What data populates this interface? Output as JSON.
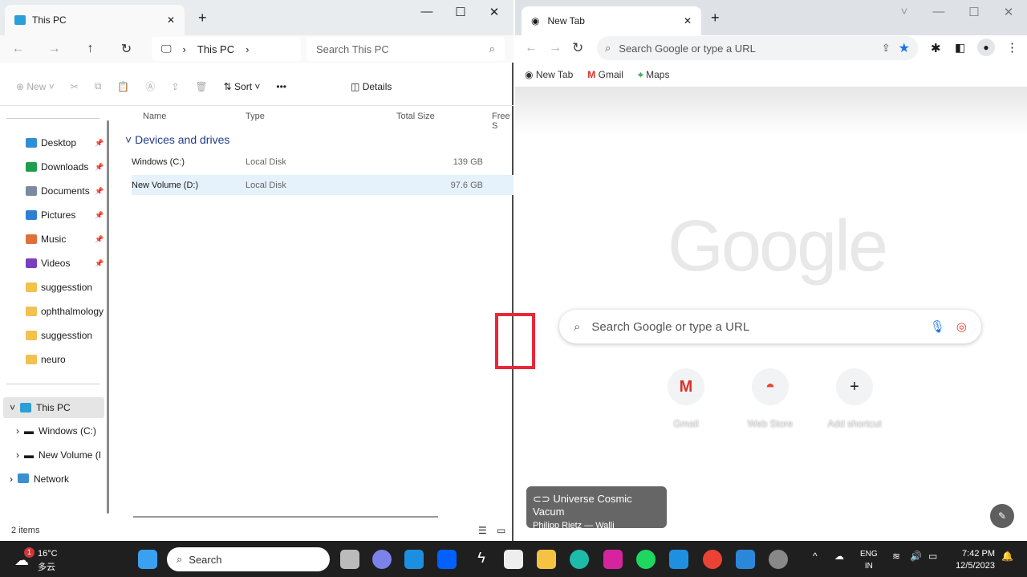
{
  "explorer": {
    "tab_title": "This PC",
    "breadcrumb": "This PC",
    "search_placeholder": "Search This PC",
    "toolbar": {
      "new": "New",
      "sort": "Sort",
      "more": "•••",
      "details": "Details"
    },
    "columns": [
      "Name",
      "Type",
      "Total Size",
      "Free S"
    ],
    "group": "Devices and drives",
    "drives": [
      {
        "name": "Windows (C:)",
        "type": "Local Disk",
        "size": "139 GB"
      },
      {
        "name": "New Volume (D:)",
        "type": "Local Disk",
        "size": "97.6 GB"
      }
    ],
    "quick_access": [
      {
        "label": "Desktop",
        "color": "#2f8fd6"
      },
      {
        "label": "Downloads",
        "color": "#1e9e4a"
      },
      {
        "label": "Documents",
        "color": "#7a8aa0"
      },
      {
        "label": "Pictures",
        "color": "#2f7fd6"
      },
      {
        "label": "Music",
        "color": "#e0703a"
      },
      {
        "label": "Videos",
        "color": "#7a3fc0"
      },
      {
        "label": "suggesstion",
        "color": "#f2c14e"
      },
      {
        "label": "ophthalmology",
        "color": "#f2c14e"
      },
      {
        "label": "suggesstion",
        "color": "#f2c14e"
      },
      {
        "label": "neuro",
        "color": "#f2c14e"
      }
    ],
    "tree": {
      "this_pc": "This PC",
      "c": "Windows (C:)",
      "d": "New Volume (I",
      "network": "Network"
    },
    "status": "2 items"
  },
  "chrome": {
    "tab_title": "New Tab",
    "omnibox_placeholder": "Search Google or type a URL",
    "bookmarks": [
      "New Tab",
      "Gmail",
      "Maps"
    ],
    "logo": "Google",
    "search_placeholder": "Search Google or type a URL",
    "shortcuts": [
      "Gmail",
      "Web Store",
      "Add shortcut"
    ],
    "credit_title": "Universe Cosmic Vacum",
    "credit_author": "Philipp Rietz — Walli"
  },
  "taskbar": {
    "weather_temp": "16°C",
    "weather_desc": "多云",
    "weather_badge": "1",
    "search": "Search",
    "lang1": "ENG",
    "lang2": "IN",
    "time": "7:42 PM",
    "date": "12/5/2023"
  }
}
